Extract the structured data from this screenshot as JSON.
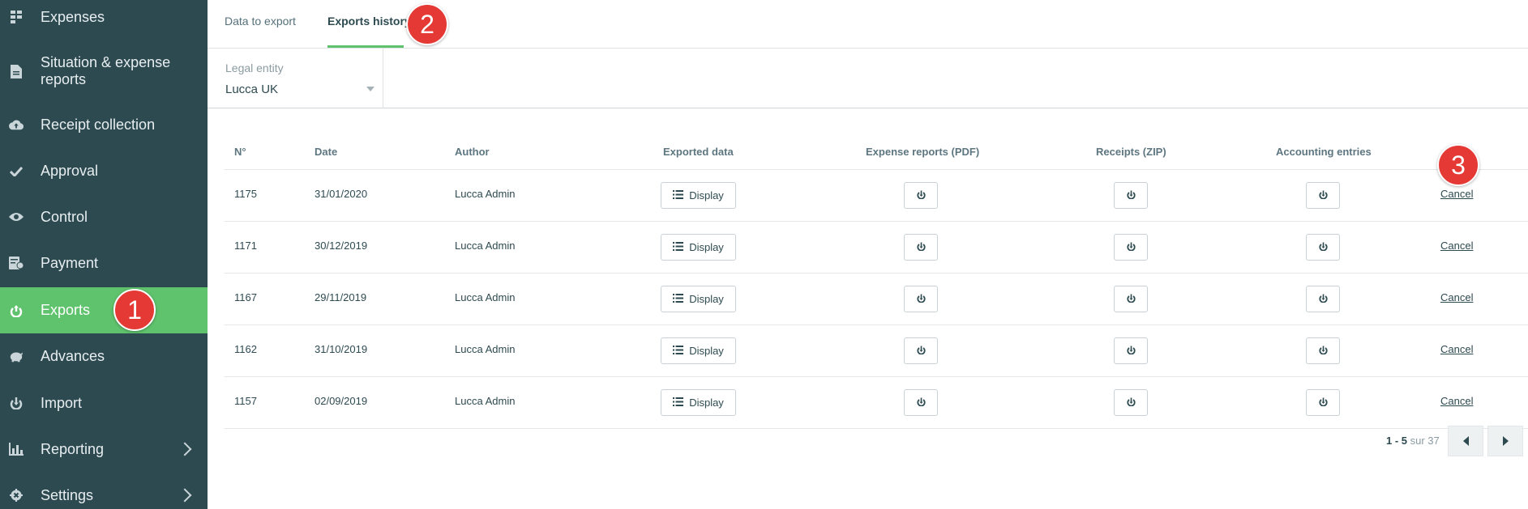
{
  "sidebar": {
    "items": [
      {
        "label": "Expenses",
        "icon": "grid-icon"
      },
      {
        "label": "Situation & expense reports",
        "icon": "document-icon"
      },
      {
        "label": "Receipt collection",
        "icon": "cloud-upload-icon"
      },
      {
        "label": "Approval",
        "icon": "check-icon"
      },
      {
        "label": "Control",
        "icon": "eye-icon"
      },
      {
        "label": "Payment",
        "icon": "payment-icon"
      },
      {
        "label": "Exports",
        "icon": "export-icon",
        "active": true
      },
      {
        "label": "Advances",
        "icon": "piggy-bank-icon"
      },
      {
        "label": "Import",
        "icon": "import-icon"
      },
      {
        "label": "Reporting",
        "icon": "bar-chart-icon",
        "has_submenu": true
      },
      {
        "label": "Settings",
        "icon": "gear-icon",
        "has_submenu": true
      }
    ]
  },
  "badges": {
    "one": "1",
    "two": "2",
    "three": "3"
  },
  "tabs": [
    {
      "label": "Data to export",
      "active": false
    },
    {
      "label": "Exports history",
      "active": true
    }
  ],
  "filter": {
    "label": "Legal entity",
    "value": "Lucca UK"
  },
  "table": {
    "headers": [
      "N°",
      "Date",
      "Author",
      "Exported data",
      "Expense reports (PDF)",
      "Receipts (ZIP)",
      "Accounting entries"
    ],
    "display_label": "Display",
    "cancel_label": "Cancel",
    "rows": [
      {
        "number": "1175",
        "date": "31/01/2020",
        "author": "Lucca Admin"
      },
      {
        "number": "1171",
        "date": "30/12/2019",
        "author": "Lucca Admin"
      },
      {
        "number": "1167",
        "date": "29/11/2019",
        "author": "Lucca Admin"
      },
      {
        "number": "1162",
        "date": "31/10/2019",
        "author": "Lucca Admin"
      },
      {
        "number": "1157",
        "date": "02/09/2019",
        "author": "Lucca Admin"
      }
    ]
  },
  "pagination": {
    "range": "1 - 5",
    "of_label": "sur 37"
  },
  "colors": {
    "sidebar": "#2d4a51",
    "accent": "#5fc26c",
    "badge": "#e53935"
  }
}
